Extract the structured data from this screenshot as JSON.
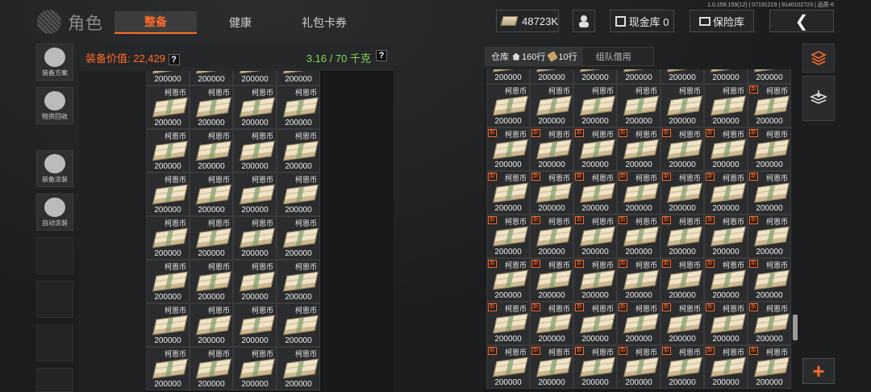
{
  "version": "1.0.159.159(12) | 07191219 | 9140102723 | 品质-6",
  "page_title": "角色",
  "tabs": [
    {
      "label": "整备",
      "active": true
    },
    {
      "label": "健康",
      "active": false
    },
    {
      "label": "礼包卡券",
      "active": false
    }
  ],
  "topbar": {
    "currency": "48723K",
    "cash_vault": "现金库 0",
    "safe_box": "保险库"
  },
  "sidebar": [
    {
      "label": "装备方案",
      "icon": "loadout-icon"
    },
    {
      "label": "物资回收",
      "icon": "recycle-icon"
    },
    {
      "label": "装备涂装",
      "icon": "paint-helmet-icon"
    },
    {
      "label": "自动涂装",
      "icon": "auto-paint-icon"
    }
  ],
  "equipment": {
    "value_label": "装备价值: 22,429",
    "weight": "3.16 / 70 千克",
    "help": "?"
  },
  "warehouse": {
    "tab_label": "仓库",
    "rows_total": "160行",
    "rows_used": "10行",
    "team_tab": "组队借用"
  },
  "item": {
    "name": "柯恩币",
    "quantity": "200000",
    "new_badge": "新"
  },
  "colors": {
    "accent": "#ff6a2a",
    "weight_green": "#7ed957"
  }
}
